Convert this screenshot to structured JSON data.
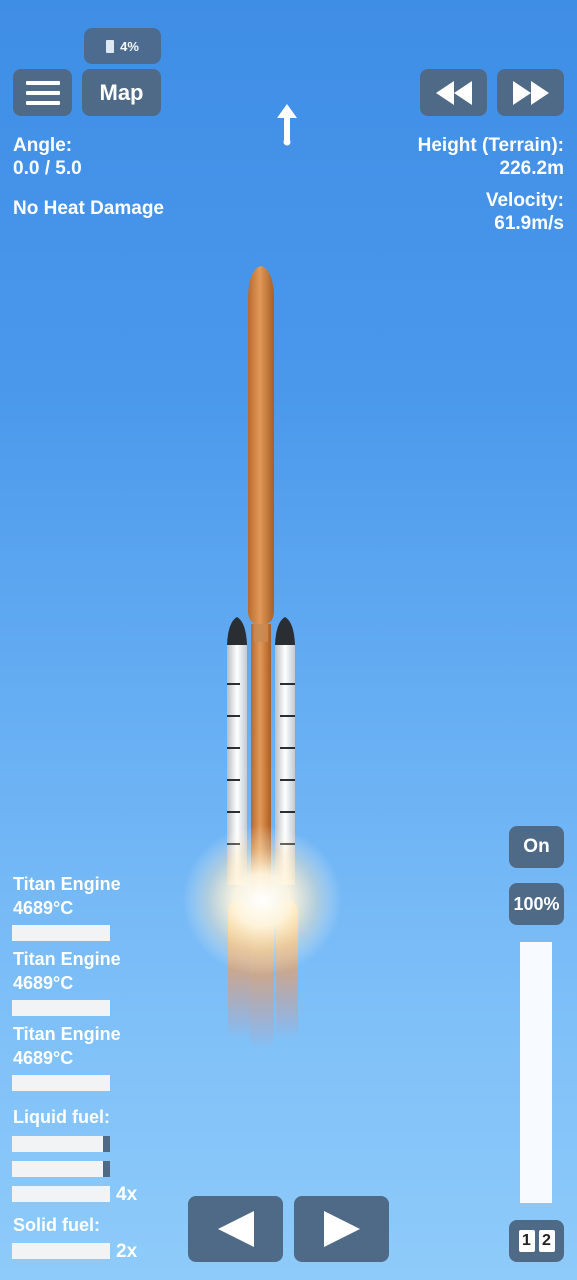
{
  "battery": {
    "label": "4%"
  },
  "toolbar": {
    "map_label": "Map"
  },
  "hud": {
    "angle_label": "Angle:",
    "angle_value": "0.0 / 5.0",
    "heat_status": "No Heat Damage",
    "height_label": "Height (Terrain):",
    "height_value": "226.2m",
    "velocity_label": "Velocity:",
    "velocity_value": "61.9m/s"
  },
  "engines": [
    {
      "name": "Titan Engine",
      "temp": "4689°C"
    },
    {
      "name": "Titan Engine",
      "temp": "4689°C"
    },
    {
      "name": "Titan Engine",
      "temp": "4689°C"
    }
  ],
  "fuel": {
    "liquid_label": "Liquid fuel:",
    "liquid_multiplier": "4x",
    "solid_label": "Solid fuel:",
    "solid_multiplier": "2x"
  },
  "throttle": {
    "toggle_label": "On",
    "percent_label": "100%",
    "level": 1.0
  },
  "stage_indicator": {
    "first": "1",
    "second": "2"
  },
  "colors": {
    "sky_top": "#3f8ee6",
    "sky_bottom": "#8ecbfa",
    "button": "#4f6a86",
    "tank": "#d9894a"
  }
}
